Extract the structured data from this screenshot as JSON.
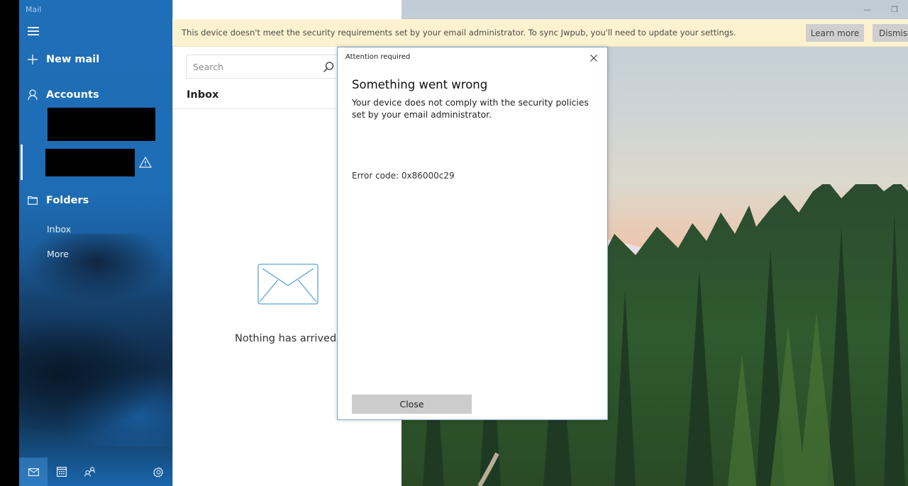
{
  "app": {
    "title": "Mail"
  },
  "sidebar": {
    "new_mail_label": "New mail",
    "accounts_label": "Accounts",
    "folders_label": "Folders",
    "folders": [
      {
        "label": "Inbox"
      },
      {
        "label": "More"
      }
    ],
    "account_warning_icon": "warning-triangle-icon",
    "bottom_icons": [
      "mail-icon",
      "calendar-icon",
      "people-icon",
      "settings-gear-icon"
    ]
  },
  "list_pane": {
    "search_placeholder": "Search",
    "folder_title": "Inbox",
    "empty_message": "Nothing has arrived ye"
  },
  "banner": {
    "message": "This device doesn't meet the security requirements set by your email administrator. To sync Jwpub, you'll need to update your settings.",
    "learn_more_label": "Learn more",
    "dismiss_label": "Dismiss"
  },
  "window_controls": {
    "minimize": "—",
    "restore": "❐"
  },
  "dialog": {
    "caption": "Attention required",
    "heading": "Something went wrong",
    "body": "Your device does not comply with the security policies set by your email administrator.",
    "error_code": "Error code: 0x86000c29",
    "close_button_label": "Close"
  },
  "colors": {
    "accent": "#1f6fb8",
    "banner_bg": "#fdf2d0",
    "dialog_border": "#7aa7d6",
    "button_gray": "#cccccc"
  }
}
